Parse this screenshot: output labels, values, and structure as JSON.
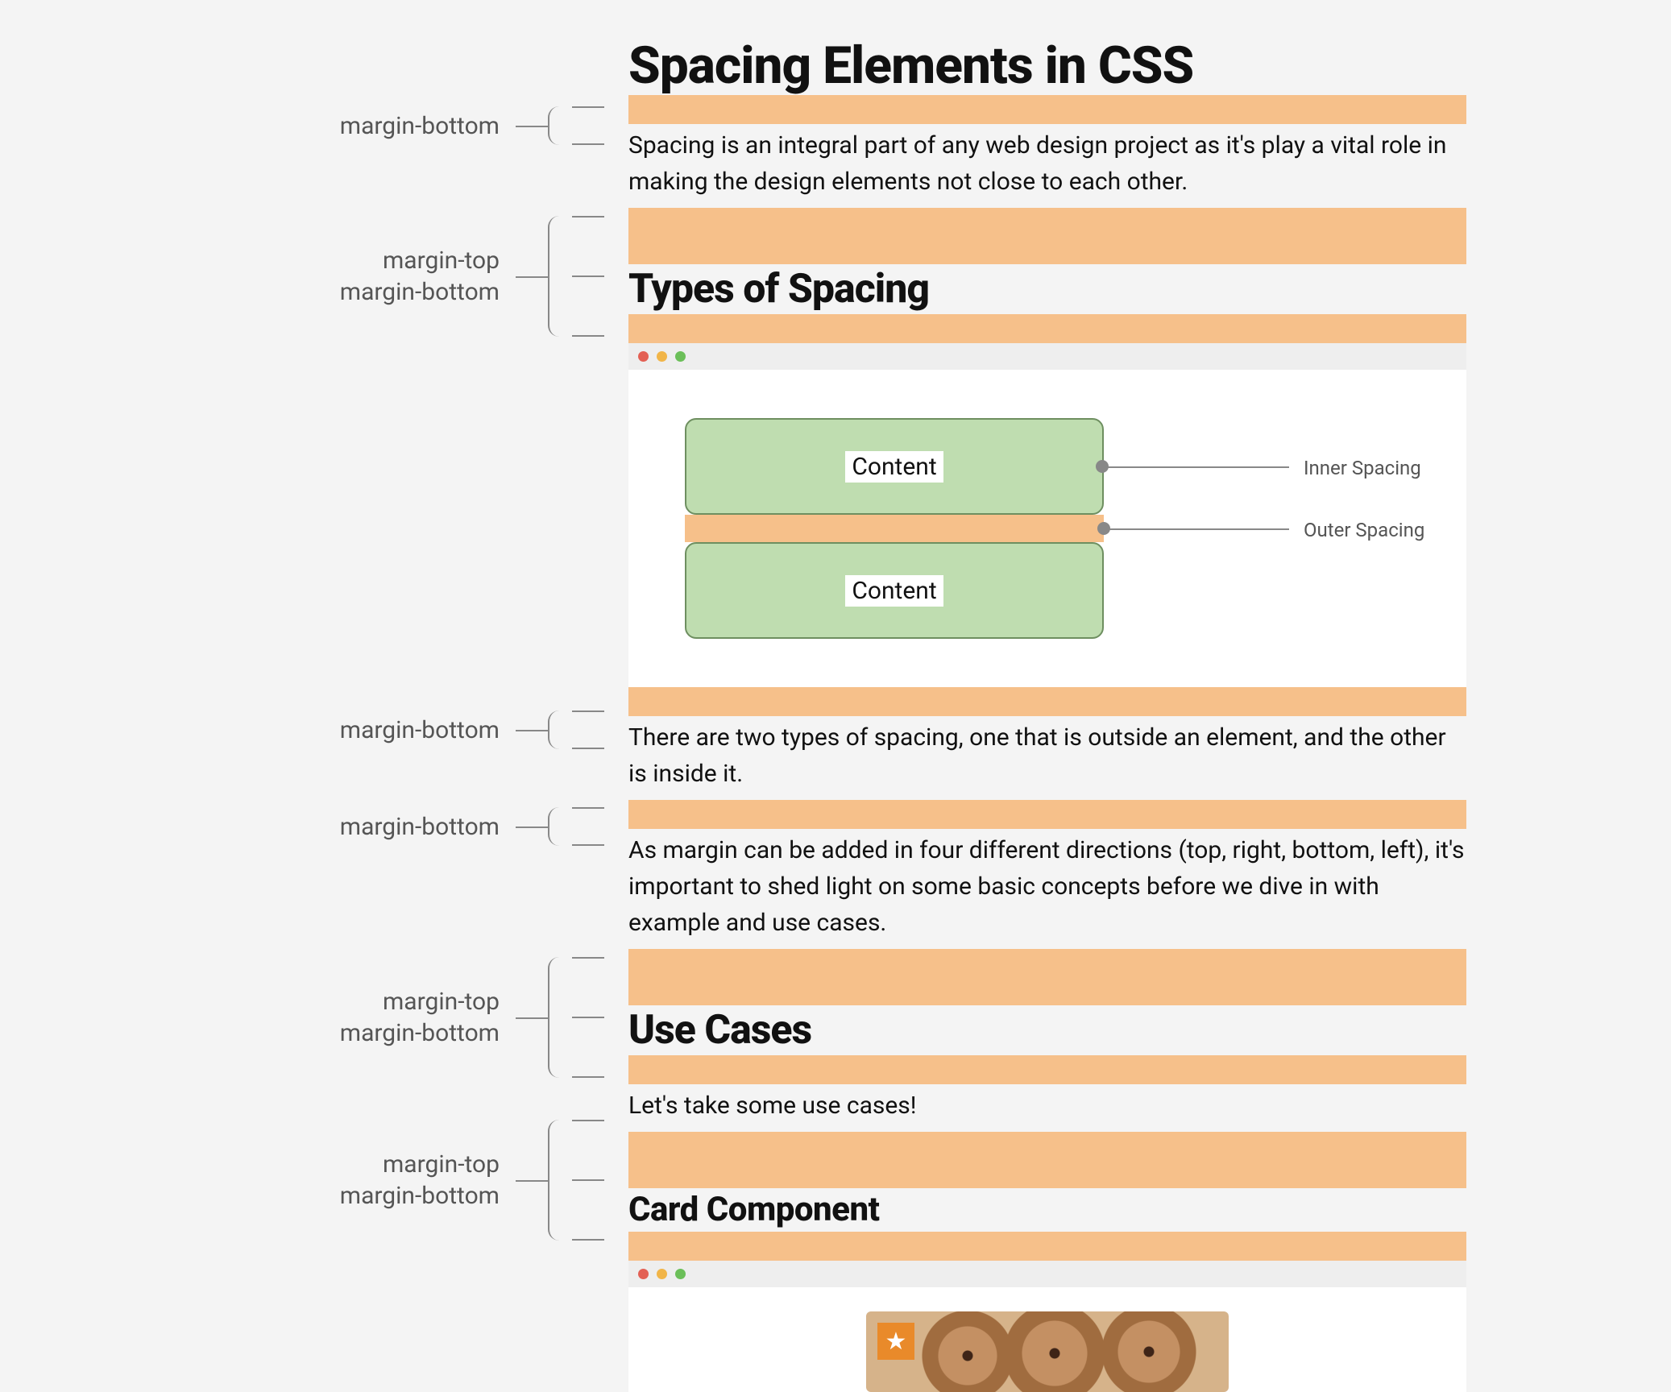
{
  "labels": {
    "mb": "margin-bottom",
    "mt": "margin-top",
    "mtmb": "margin-top\nmargin-bottom"
  },
  "article": {
    "h1": "Spacing Elements in CSS",
    "p1": "Spacing is an integral part of any web design project as it's play a vital role in making the design elements not close to each other.",
    "h2": "Types of Spacing",
    "p2": "There are two types of spacing, one that is outside an element, and the other is inside it.",
    "p3": "As margin can be added in four different directions (top, right, bottom, left), it's important to shed light on some basic concepts before we dive in with example and use cases.",
    "h3": "Use Cases",
    "p4": "Let's take some use cases!",
    "h4": "Card Component"
  },
  "window1": {
    "box_label": "Content",
    "anno_inner": "Inner Spacing",
    "anno_outer": "Outer Spacing"
  },
  "window2": {
    "badge_icon": "★"
  }
}
